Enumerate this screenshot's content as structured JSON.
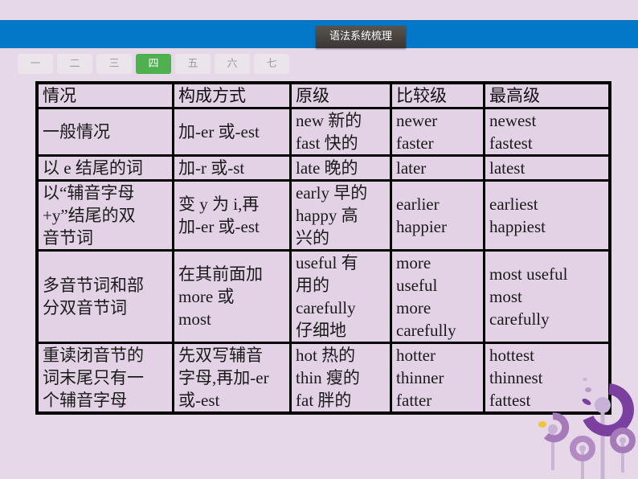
{
  "header": {
    "title": "语法系统梳理",
    "bar_color": "#0378c8"
  },
  "tabs": [
    {
      "label": "一",
      "active": false
    },
    {
      "label": "二",
      "active": false
    },
    {
      "label": "三",
      "active": false
    },
    {
      "label": "四",
      "active": true
    },
    {
      "label": "五",
      "active": false
    },
    {
      "label": "六",
      "active": false
    },
    {
      "label": "七",
      "active": false
    }
  ],
  "active_tab_color": "#4fb04f",
  "table": {
    "headers": [
      "情况",
      "构成方式",
      "原级",
      "比较级",
      "最高级"
    ],
    "rows": [
      {
        "situation": [
          "一般情况"
        ],
        "rule": [
          "加-er 或-est"
        ],
        "positive": [
          "new 新的",
          "fast 快的"
        ],
        "comparative": [
          "newer",
          "faster"
        ],
        "superlative": [
          "newest",
          "fastest"
        ]
      },
      {
        "situation": [
          "以 e 结尾的词"
        ],
        "rule": [
          "加-r 或-st"
        ],
        "positive": [
          "late 晚的"
        ],
        "comparative": [
          "later"
        ],
        "superlative": [
          "latest"
        ]
      },
      {
        "situation": [
          "以“辅音字母",
          "+y”结尾的双",
          "音节词"
        ],
        "rule": [
          "变 y 为 i,再",
          "加-er 或-est"
        ],
        "positive": [
          "early 早的",
          "happy 高",
          "兴的"
        ],
        "comparative": [
          "earlier",
          "happier"
        ],
        "superlative": [
          "earliest",
          "happiest"
        ]
      },
      {
        "situation": [
          "多音节词和部",
          "分双音节词"
        ],
        "rule": [
          "在其前面加",
          "more 或",
          "most"
        ],
        "positive": [
          "useful 有",
          "用的",
          "carefully",
          "仔细地"
        ],
        "comparative": [
          "more",
          "useful",
          "more",
          "carefully"
        ],
        "superlative": [
          "most useful",
          "most",
          "carefully"
        ]
      },
      {
        "situation": [
          "重读闭音节的",
          "词末尾只有一",
          "个辅音字母"
        ],
        "rule": [
          "先双写辅音",
          "字母,再加-er",
          "或-est"
        ],
        "positive": [
          "hot 热的",
          "thin 瘦的",
          "fat 胖的"
        ],
        "comparative": [
          "hotter",
          "thinner",
          "fatter"
        ],
        "superlative": [
          "hottest",
          "thinnest",
          "fattest"
        ]
      }
    ]
  }
}
